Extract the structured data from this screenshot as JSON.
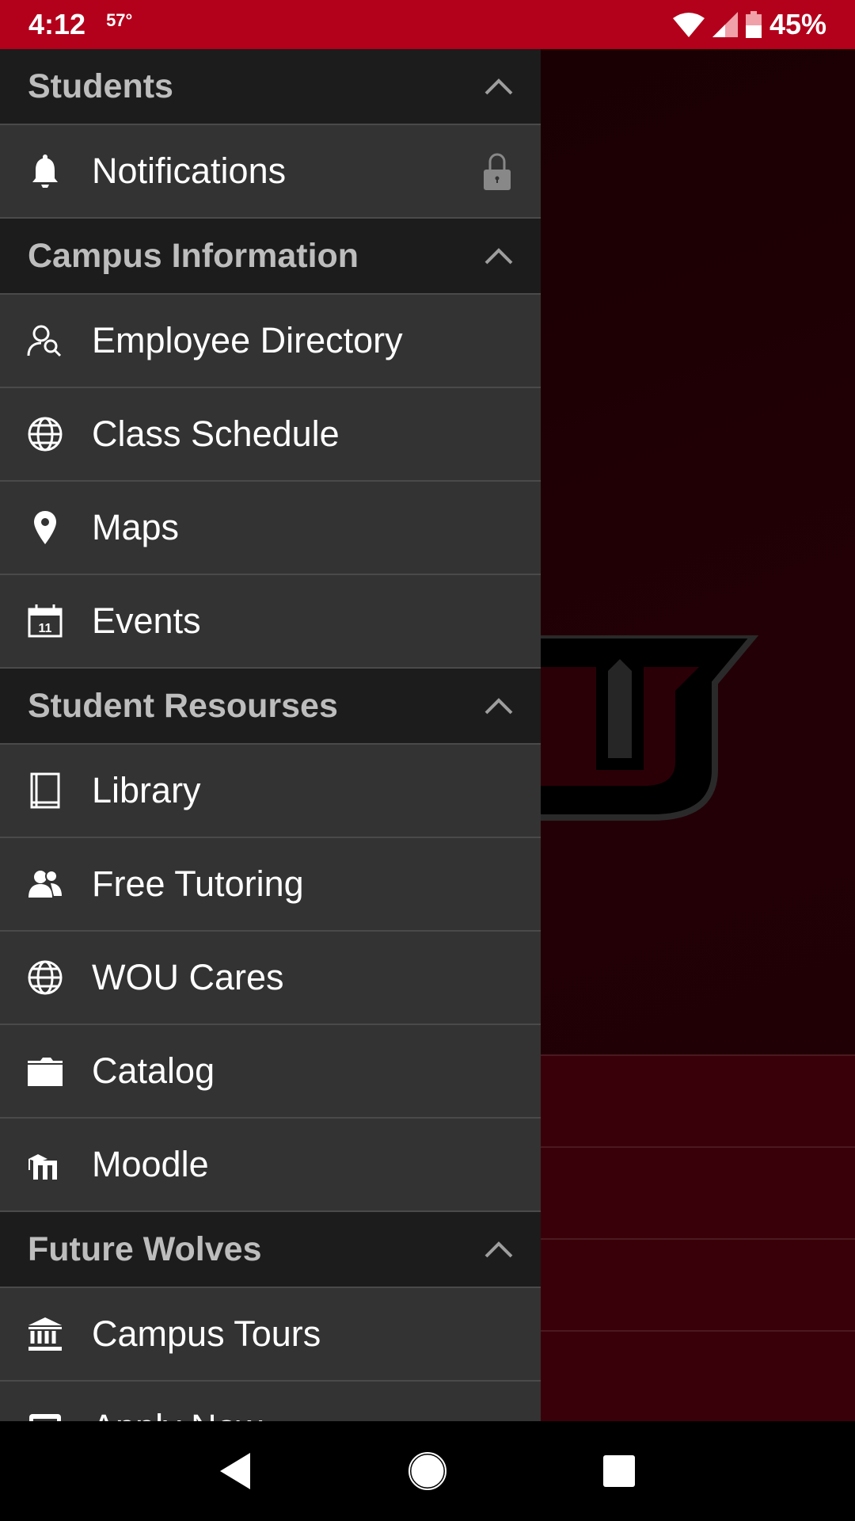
{
  "status_bar": {
    "time": "4:12",
    "temperature": "57°",
    "battery": "45%",
    "icons": [
      "wifi-icon",
      "signal-icon",
      "battery-icon"
    ]
  },
  "colors": {
    "status_bar": "#b3001b",
    "drawer_bg": "#333333",
    "header_bg": "#1c1c1c",
    "header_text": "#bdbdbd"
  },
  "drawer": {
    "sections": [
      {
        "title": "Students",
        "items": [
          {
            "label": "Notifications",
            "icon": "bell-icon",
            "locked": true
          }
        ]
      },
      {
        "title": "Campus Information",
        "items": [
          {
            "label": "Employee Directory",
            "icon": "person-search-icon"
          },
          {
            "label": "Class Schedule",
            "icon": "globe-icon"
          },
          {
            "label": "Maps",
            "icon": "map-pin-icon"
          },
          {
            "label": "Events",
            "icon": "calendar-icon"
          }
        ]
      },
      {
        "title": "Student Resourses",
        "items": [
          {
            "label": "Library",
            "icon": "book-icon"
          },
          {
            "label": "Free Tutoring",
            "icon": "people-icon"
          },
          {
            "label": "WOU Cares",
            "icon": "globe-icon"
          },
          {
            "label": "Catalog",
            "icon": "folder-icon"
          },
          {
            "label": "Moodle",
            "icon": "moodle-icon"
          }
        ]
      },
      {
        "title": "Future Wolves",
        "items": [
          {
            "label": "Campus Tours",
            "icon": "institution-icon"
          },
          {
            "label": "Apply Now",
            "icon": "form-icon"
          }
        ]
      }
    ]
  },
  "calendar_day": "11",
  "nav": {
    "buttons": [
      "back",
      "home",
      "recents"
    ]
  }
}
